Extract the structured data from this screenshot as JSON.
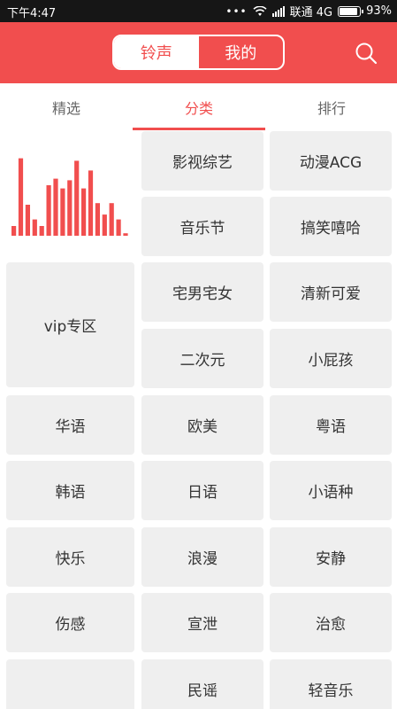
{
  "status_bar": {
    "time": "下午4:47",
    "dots": "•••",
    "carrier": "联通 4G",
    "battery": "93%",
    "battery_level": 0.93,
    "icons": [
      "wifi-icon",
      "signal-icon",
      "battery-icon"
    ]
  },
  "header": {
    "segments": [
      {
        "label": "铃声",
        "selected": true
      },
      {
        "label": "我的",
        "selected": false
      }
    ],
    "search_icon": "search-icon",
    "accent_color": "#f14e4e"
  },
  "tabs": [
    {
      "label": "精选",
      "selected": false
    },
    {
      "label": "分类",
      "selected": true
    },
    {
      "label": "排行",
      "selected": false
    }
  ],
  "categories": {
    "banner_icon": "equalizer-bars-icon",
    "banner_bar_levels": [
      0.12,
      0.95,
      0.38,
      0.2,
      0.12,
      0.62,
      0.7,
      0.58,
      0.68,
      0.92,
      0.58,
      0.8,
      0.4,
      0.26,
      0.4,
      0.2,
      0.03
    ],
    "vip": "vip专区",
    "left_column": [
      "华语",
      "韩语",
      "快乐",
      "伤感",
      ""
    ],
    "middle_column": [
      "影视综艺",
      "音乐节",
      "宅男宅女",
      "二次元",
      "欧美",
      "日语",
      "浪漫",
      "宣泄",
      "民谣"
    ],
    "right_column": [
      "动漫ACG",
      "搞笑嘻哈",
      "清新可爱",
      "小屁孩",
      "粤语",
      "小语种",
      "安静",
      "治愈",
      "轻音乐"
    ]
  }
}
